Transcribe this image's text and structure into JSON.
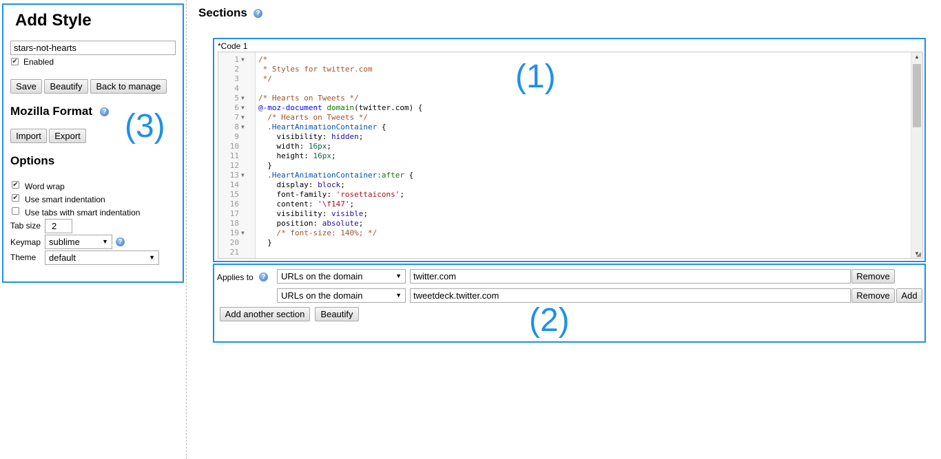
{
  "left": {
    "title": "Add Style",
    "name_value": "stars-not-hearts",
    "enabled_label": "Enabled",
    "buttons": {
      "save": "Save",
      "beautify": "Beautify",
      "back": "Back to manage"
    },
    "mozilla_format": {
      "title": "Mozilla Format",
      "import": "Import",
      "export": "Export"
    },
    "options": {
      "title": "Options",
      "word_wrap": "Word wrap",
      "smart_indent": "Use smart indentation",
      "use_tabs": "Use tabs with smart indentation",
      "tab_size_label": "Tab size",
      "tab_size_value": "2",
      "keymap_label": "Keymap",
      "keymap_value": "sublime",
      "theme_label": "Theme",
      "theme_value": "default"
    }
  },
  "sections": {
    "title": "Sections",
    "code_label": "*Code 1",
    "code_lines": [
      "/*",
      " * Styles for twitter.com",
      " */",
      "",
      "/* Hearts on Tweets */",
      "@-moz-document domain(twitter.com) {",
      "  /* Hearts on Tweets */",
      "  .HeartAnimationContainer {",
      "    visibility: hidden;",
      "    width: 16px;",
      "    height: 16px;",
      "  }",
      "  .HeartAnimationContainer:after {",
      "    display: block;",
      "    font-family: 'rosettaicons';",
      "    content: '\\f147';",
      "    visibility: visible;",
      "    position: absolute;",
      "    /* font-size: 140%; */",
      "  }",
      ""
    ],
    "applies_to_label": "Applies to",
    "rules": [
      {
        "type": "URLs on the domain",
        "value": "twitter.com",
        "remove": "Remove"
      },
      {
        "type": "URLs on the domain",
        "value": "tweetdeck.twitter.com",
        "remove": "Remove",
        "add": "Add"
      }
    ],
    "add_section": "Add another section",
    "beautify": "Beautify"
  },
  "annotations": {
    "a1": "(1)",
    "a2": "(2)",
    "a3": "(3)"
  },
  "colors": {
    "annotation": "#1e90e8"
  },
  "icons": [
    "help-icon",
    "dropdown-caret-icon",
    "fold-arrow-icon",
    "resize-grip-icon",
    "checkmark-icon"
  ]
}
